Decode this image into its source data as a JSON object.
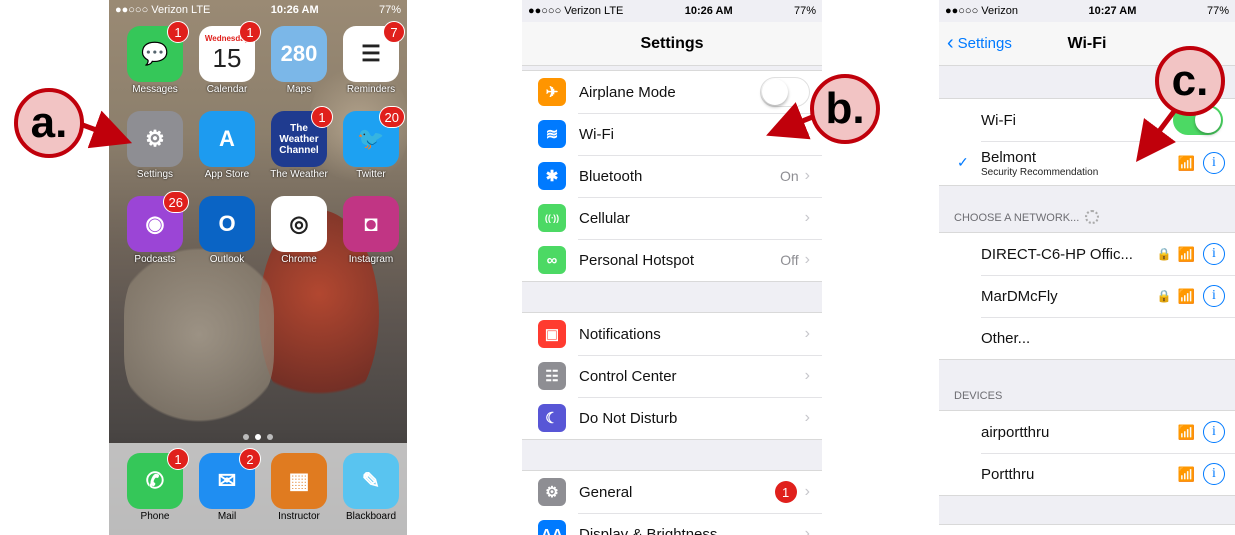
{
  "callouts": {
    "a": "a.",
    "b": "b.",
    "c": "c."
  },
  "home": {
    "status": {
      "carrier": "●●○○○ Verizon  LTE",
      "time": "10:26 AM",
      "battery": "77%"
    },
    "apps": [
      {
        "label": "Messages",
        "glyph": "💬",
        "color": "#35c759",
        "badge": "1"
      },
      {
        "label": "Calendar",
        "glyph": "15",
        "day": "Wednesday",
        "color": "#ffffff",
        "badge": "1"
      },
      {
        "label": "Maps",
        "glyph": "280",
        "color": "#7bb7e8",
        "badge": ""
      },
      {
        "label": "Reminders",
        "glyph": "☰",
        "color": "#ffffff",
        "badge": "7"
      },
      {
        "label": "Settings",
        "glyph": "⚙",
        "color": "#8e8e93",
        "badge": ""
      },
      {
        "label": "App Store",
        "glyph": "A",
        "color": "#1d9bf0",
        "badge": ""
      },
      {
        "label": "The Weather",
        "glyph": "The Weather Channel",
        "color": "#1f3b8f",
        "badge": "1"
      },
      {
        "label": "Twitter",
        "glyph": "🐦",
        "color": "#1da1f2",
        "badge": "20"
      },
      {
        "label": "Podcasts",
        "glyph": "◉",
        "color": "#9b45d6",
        "badge": "26"
      },
      {
        "label": "Outlook",
        "glyph": "O",
        "color": "#0a64c5",
        "badge": ""
      },
      {
        "label": "Chrome",
        "glyph": "◎",
        "color": "#ffffff",
        "badge": ""
      },
      {
        "label": "Instagram",
        "glyph": "◘",
        "color": "#c13584",
        "badge": ""
      }
    ],
    "dock": [
      {
        "label": "Phone",
        "glyph": "✆",
        "color": "#35c759",
        "badge": "1"
      },
      {
        "label": "Mail",
        "glyph": "✉",
        "color": "#1f8ef2",
        "badge": "2"
      },
      {
        "label": "Instructor",
        "glyph": "▦",
        "color": "#e07b20",
        "badge": ""
      },
      {
        "label": "Blackboard",
        "glyph": "✎",
        "color": "#59c4f0",
        "badge": ""
      }
    ]
  },
  "settings": {
    "status": {
      "carrier": "●●○○○ Verizon  LTE",
      "time": "10:26 AM",
      "battery": "77%"
    },
    "title": "Settings",
    "group1": [
      {
        "label": "Airplane Mode",
        "icon": "airplane-icon",
        "glyph": "✈",
        "color": "#ff9500",
        "value": "",
        "toggle": "off"
      },
      {
        "label": "Wi-Fi",
        "icon": "wifi-icon",
        "glyph": "≋",
        "color": "#007aff",
        "value": "",
        "toggle": ""
      },
      {
        "label": "Bluetooth",
        "icon": "bluetooth-icon",
        "glyph": "✱",
        "color": "#007aff",
        "value": "On",
        "toggle": ""
      },
      {
        "label": "Cellular",
        "icon": "cellular-icon",
        "glyph": "((ᐧ))",
        "color": "#4cd964",
        "value": "",
        "toggle": ""
      },
      {
        "label": "Personal Hotspot",
        "icon": "hotspot-icon",
        "glyph": "∞",
        "color": "#4cd964",
        "value": "Off",
        "toggle": ""
      }
    ],
    "group2": [
      {
        "label": "Notifications",
        "icon": "notifications-icon",
        "glyph": "▣",
        "color": "#ff3b30",
        "value": ""
      },
      {
        "label": "Control Center",
        "icon": "control-center-icon",
        "glyph": "☷",
        "color": "#8e8e93",
        "value": ""
      },
      {
        "label": "Do Not Disturb",
        "icon": "moon-icon",
        "glyph": "☾",
        "color": "#5856d6",
        "value": ""
      }
    ],
    "group3": [
      {
        "label": "General",
        "icon": "gear-icon",
        "glyph": "⚙",
        "color": "#8e8e93",
        "badge": "1"
      },
      {
        "label": "Display & Brightness",
        "icon": "display-icon",
        "glyph": "AA",
        "color": "#007aff",
        "badge": ""
      }
    ]
  },
  "wifi": {
    "status": {
      "carrier": "●●○○○ Verizon",
      "time": "10:27 AM",
      "battery": "77%"
    },
    "back_label": "Settings",
    "title": "Wi-Fi",
    "wifi_label": "Wi-Fi",
    "wifi_on": true,
    "connected": {
      "name": "Belmont",
      "subtitle": "Security Recommendation"
    },
    "choose_header": "CHOOSE A NETWORK...",
    "networks": [
      {
        "name": "DIRECT-C6-HP Offic...",
        "locked": true
      },
      {
        "name": "MarDMcFly",
        "locked": true
      },
      {
        "name": "Other...",
        "locked": false,
        "other": true
      }
    ],
    "devices_header": "DEVICES",
    "devices": [
      {
        "name": "airportthru"
      },
      {
        "name": "Portthru"
      }
    ]
  }
}
